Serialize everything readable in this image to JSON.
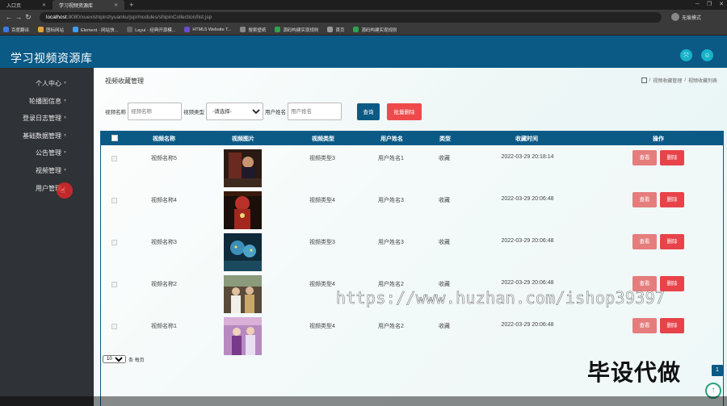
{
  "browser": {
    "tabs": [
      {
        "label": "入口页",
        "active": false
      },
      {
        "label": "学习视频资源库",
        "active": true
      }
    ],
    "url_host": "localhost",
    "url_rest": ":8080/xuexishipinziyuanku/jsp/modules/shipinCollection/list.jsp",
    "profile_label": "无痕模式",
    "bookmarks": [
      "百度翻译",
      "图标网站",
      "Element - 网站快...",
      "Layui - 经典开源模...",
      "HTML5 Website T...",
      "搜索壁纸",
      "源码构建实现规则",
      "首页",
      "源码构建实现规则"
    ]
  },
  "header": {
    "title": "学习视频资源库",
    "accent": "#0b5a86",
    "button_color": "#17b3c8"
  },
  "sidebar": {
    "items": [
      {
        "label": "个人中心"
      },
      {
        "label": "轮播图信息"
      },
      {
        "label": "登录日志管理"
      },
      {
        "label": "基础数据管理"
      },
      {
        "label": "公告管理"
      },
      {
        "label": "视频管理"
      },
      {
        "label": "用户管理"
      }
    ]
  },
  "main": {
    "page_title": "视频收藏管理",
    "breadcrumb": [
      "视频收藏管理",
      "视频收藏列表"
    ],
    "search": {
      "name_label": "视频名称",
      "name_placeholder": "视频名称",
      "type_label": "视频类型",
      "type_selected": "-请选择-",
      "user_label": "用户姓名",
      "user_placeholder": "用户姓名",
      "query_button": "查询",
      "batch_delete_button": "批量删除"
    },
    "table": {
      "columns": [
        "视频名称",
        "视频图片",
        "视频类型",
        "用户姓名",
        "类型",
        "收藏时间",
        "操作"
      ],
      "rows": [
        {
          "name": "视频名称5",
          "type": "视频类型3",
          "user": "用户姓名1",
          "kind": "收藏",
          "time": "2022-03-29 20:18:14",
          "thumb": "thumb-1"
        },
        {
          "name": "视频名称4",
          "type": "视频类型4",
          "user": "用户姓名3",
          "kind": "收藏",
          "time": "2022-03-29 20:06:48",
          "thumb": "thumb-2"
        },
        {
          "name": "视频名称3",
          "type": "视频类型3",
          "user": "用户姓名3",
          "kind": "收藏",
          "time": "2022-03-29 20:06:48",
          "thumb": "thumb-3"
        },
        {
          "name": "视频名称2",
          "type": "视频类型4",
          "user": "用户姓名2",
          "kind": "收藏",
          "time": "2022-03-29 20:06:48",
          "thumb": "thumb-4"
        },
        {
          "name": "视频名称1",
          "type": "视频类型4",
          "user": "用户姓名2",
          "kind": "收藏",
          "time": "2022-03-29 20:06:48",
          "thumb": "thumb-5"
        }
      ],
      "view_label": "查看",
      "delete_label": "删除"
    },
    "pager": {
      "page_size": "10",
      "per_page_label": "条 每页",
      "current_page": "1"
    }
  },
  "overlay": {
    "watermark": "https://www.huzhan.com/ishop39397",
    "stamp": "毕设代做"
  }
}
